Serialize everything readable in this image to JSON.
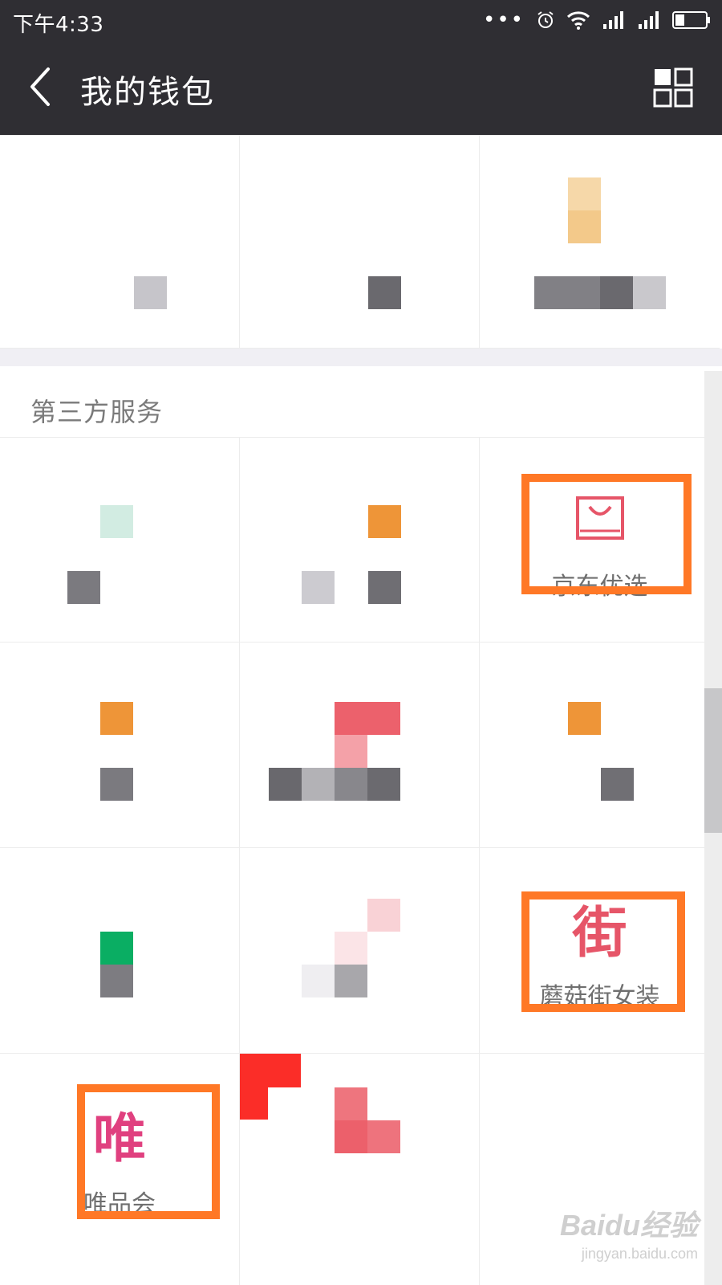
{
  "status_bar": {
    "time": "下午4:33",
    "icons": [
      "more-dots-icon",
      "alarm-icon",
      "wifi-icon",
      "signal-icon",
      "signal-icon",
      "battery-icon"
    ]
  },
  "app_bar": {
    "title": "我的钱包",
    "back_icon": "chevron-left-icon",
    "menu_icon": "grid-icon"
  },
  "sections": {
    "third_party": {
      "title": "第三方服务",
      "items": [
        {
          "label": "京东优选",
          "icon": "shopping-bag-icon",
          "highlighted": true
        },
        {
          "label": "蘑菇街女装",
          "icon": "街",
          "highlighted": true
        },
        {
          "label": "唯品会",
          "icon": "唯",
          "highlighted": true
        }
      ]
    }
  },
  "colors": {
    "header_bg": "#2f2e33",
    "highlight": "#ff7826",
    "jd_icon": "#e65568",
    "mogujie_icon": "#e65568",
    "vip_icon": "#e0407f"
  },
  "watermark": {
    "logo": "Baidu经验",
    "url": "jingyan.baidu.com"
  }
}
